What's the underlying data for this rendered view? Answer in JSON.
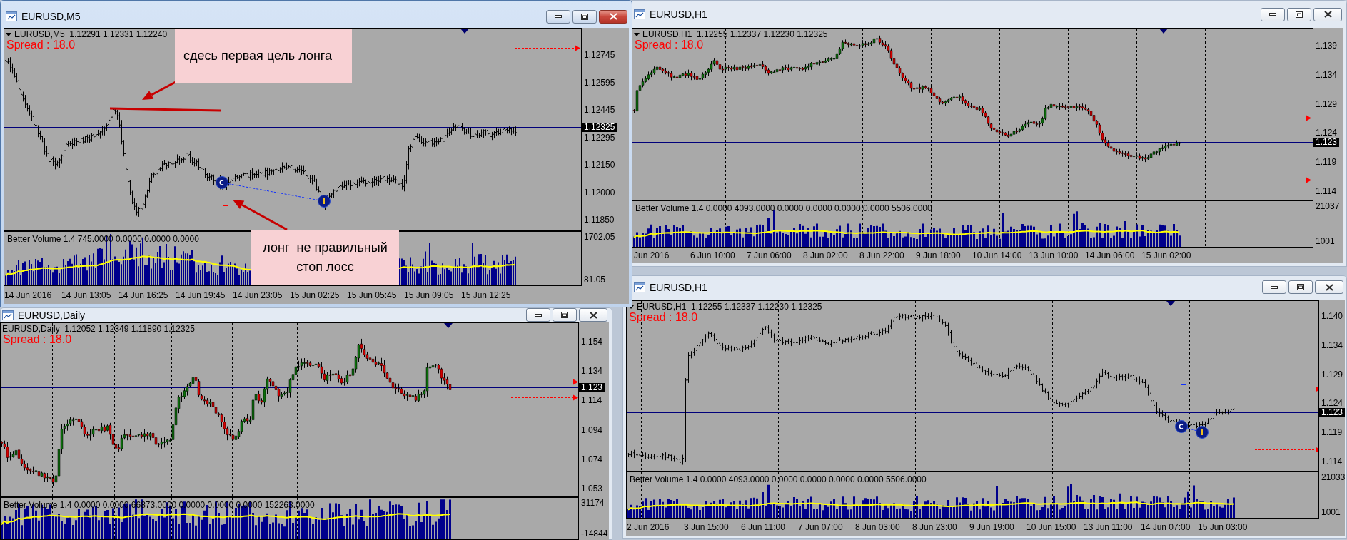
{
  "windows": [
    {
      "title": "EURUSD,M5",
      "active": true,
      "kind": "bars",
      "header": "EURUSD,M5  1.12291 1.12331 1.12240",
      "spread": "Spread : 18.0",
      "price_axis": [
        "1.12745",
        "1.12595",
        "1.12445",
        "1.12295",
        "1.12150",
        "1.12000",
        "1.11850"
      ],
      "current_price": "1.12325",
      "volume_header": "Better Volume 1.4 745.0000 0.0000 0.0000 0.0000",
      "volume_axis": [
        "1702.05",
        "81.05"
      ],
      "time_axis": [
        "14 Jun 2016",
        "14 Jun 13:05",
        "14 Jun 16:25",
        "14 Jun 19:45",
        "14 Jun 23:05",
        "15 Jun 02:25",
        "15 Jun 05:45",
        "15 Jun 09:05",
        "15 Jun 12:25"
      ],
      "notes": [
        "сдесь первая цель лонга",
        "лонг  не правильный\nстоп лосс"
      ]
    },
    {
      "title": "EURUSD,Daily",
      "active": false,
      "kind": "candles",
      "header": "EURUSD,Daily  1.12052 1.12349 1.11890 1.12325",
      "spread": "Spread : 18.0",
      "price_axis": [
        "1.154",
        "1.134",
        "1.114",
        "1.094",
        "1.074",
        "1.053"
      ],
      "current_price": "1.123",
      "volume_header": "Better Volume 1.4 0.0000 0.0000 66873.0000 0.0000 0.0000 0.0000 152263.0000",
      "volume_axis": [
        "31174",
        "-14844"
      ]
    },
    {
      "title": "EURUSD,H1",
      "active": false,
      "kind": "candles",
      "header": "EURUSD,H1  1.12255 1.12337 1.12230 1.12325",
      "spread": "Spread : 18.0",
      "price_axis": [
        "1.139",
        "1.134",
        "1.129",
        "1.124",
        "1.119",
        "1.114"
      ],
      "current_price": "1.123",
      "volume_header": "Better Volume 1.4 0.0000 4093.0000 0.0000 0.0000 0.0000 0.0000 5506.0000",
      "volume_axis": [
        "21037",
        "1001"
      ],
      "time_axis": [
        "Jun 2016",
        "6 Jun 10:00",
        "7 Jun 06:00",
        "8 Jun 02:00",
        "8 Jun 22:00",
        "9 Jun 18:00",
        "10 Jun 14:00",
        "13 Jun 10:00",
        "14 Jun 06:00",
        "15 Jun 02:00"
      ]
    },
    {
      "title": "EURUSD,H1",
      "active": false,
      "kind": "bars",
      "header": "EURUSD,H1  1.12255 1.12337 1.12230 1.12325",
      "spread": "Spread : 18.0",
      "price_axis": [
        "1.140",
        "1.134",
        "1.129",
        "1.124",
        "1.119",
        "1.114"
      ],
      "current_price": "1.123",
      "volume_header": "Better Volume 1.4 0.0000 4093.0000 0.0000 0.0000 0.0000 0.0000 5506.0000",
      "volume_axis": [
        "21033",
        "1001"
      ],
      "time_axis": [
        "2 Jun 2016",
        "3 Jun 15:00",
        "6 Jun 11:00",
        "7 Jun 07:00",
        "8 Jun 03:00",
        "8 Jun 23:00",
        "9 Jun 19:00",
        "10 Jun 15:00",
        "13 Jun 11:00",
        "14 Jun 07:00",
        "15 Jun 03:00"
      ]
    }
  ]
}
